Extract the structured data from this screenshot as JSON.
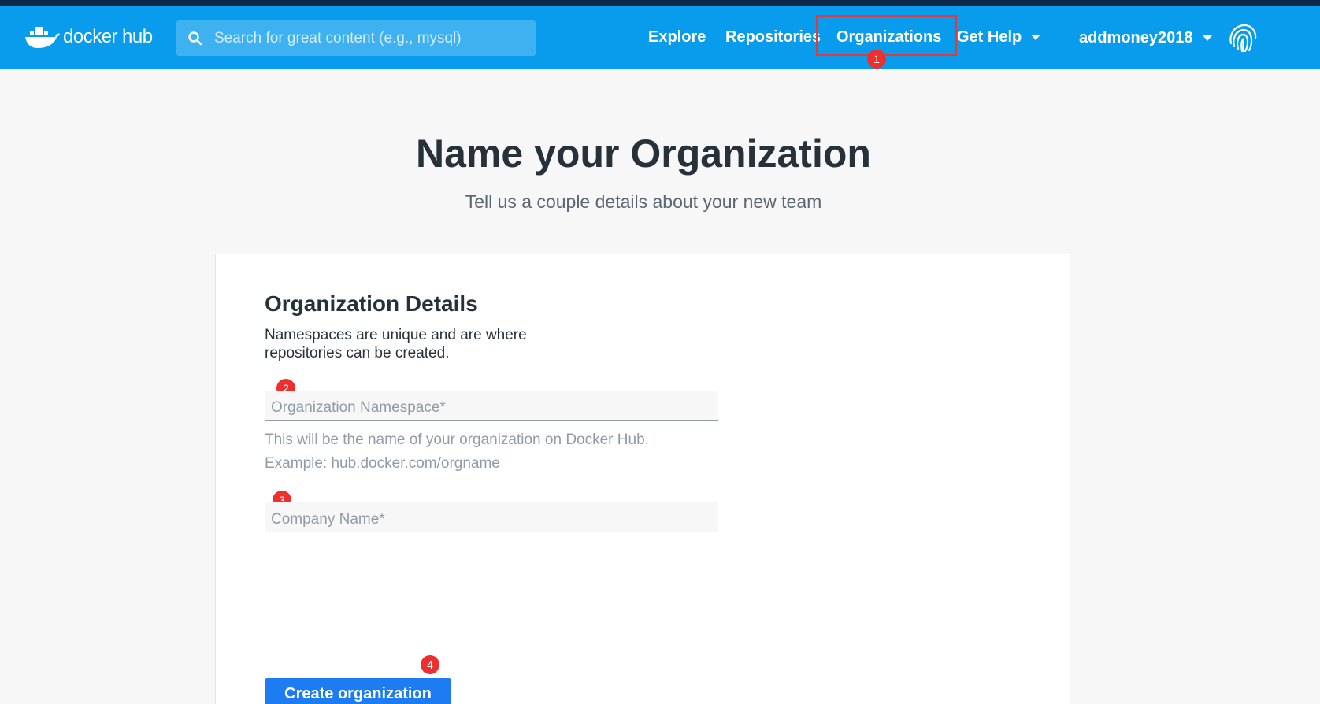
{
  "brand": {
    "name": "docker",
    "suffix": "hub"
  },
  "search": {
    "placeholder": "Search for great content (e.g., mysql)"
  },
  "nav": {
    "explore": "Explore",
    "repositories": "Repositories",
    "organizations": "Organizations",
    "get_help": "Get Help",
    "username": "addmoney2018"
  },
  "markers": {
    "m1": "1",
    "m2": "2",
    "m3": "3",
    "m4": "4"
  },
  "page": {
    "title": "Name your Organization",
    "subtitle": "Tell us a couple details about your new team"
  },
  "form": {
    "section_title": "Organization Details",
    "description": "Namespaces are unique and are where repositories can be created.",
    "namespace_placeholder": "Organization Namespace*",
    "namespace_help_1": "This will be the name of your organization on Docker Hub.",
    "namespace_help_2": "Example: hub.docker.com/orgname",
    "company_placeholder": "Company Name*",
    "submit_label": "Create organization"
  },
  "colors": {
    "navbar": "#099cec",
    "top_strip": "#0b2a4b",
    "primary_button": "#1d7cf2",
    "annotation_red": "#e53935"
  },
  "icons": [
    "docker-whale-icon",
    "search-icon",
    "caret-down-icon",
    "fingerprint-icon"
  ]
}
